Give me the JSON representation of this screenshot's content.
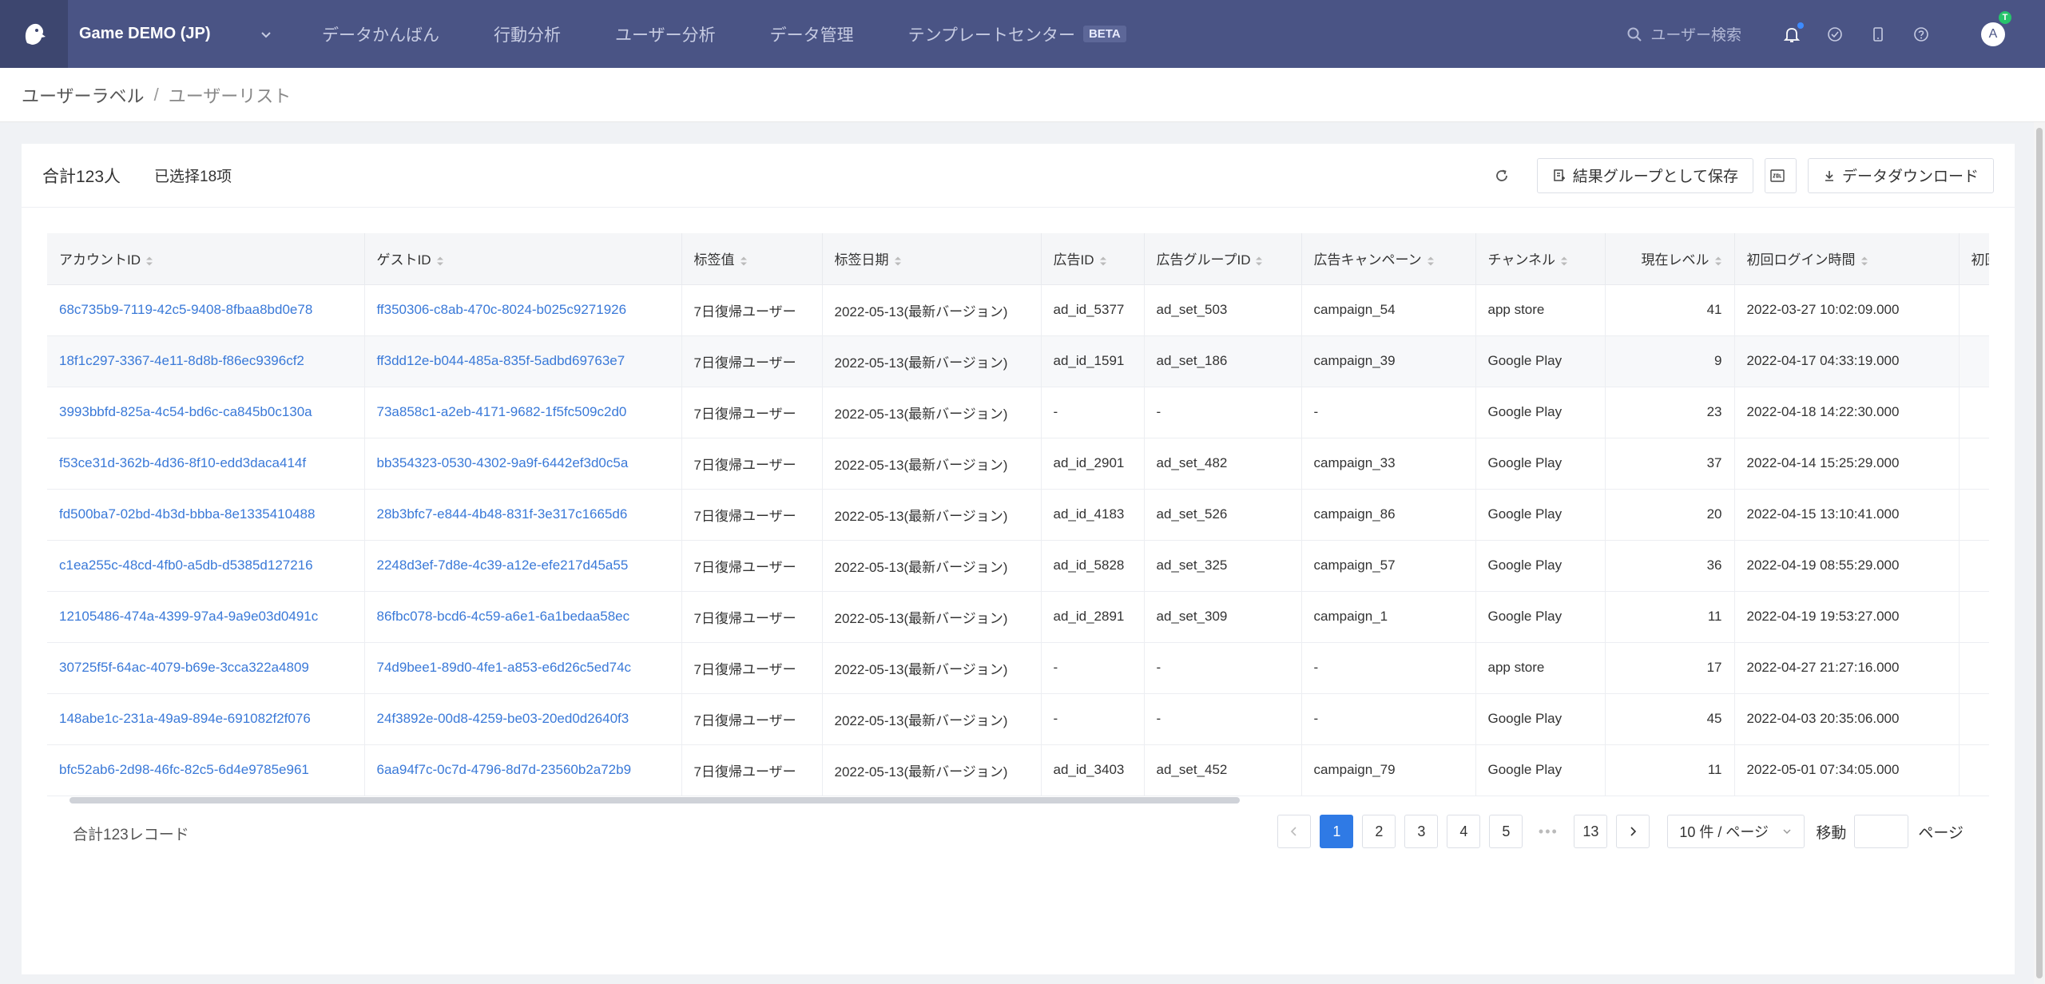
{
  "topbar": {
    "project": "Game DEMO (JP)",
    "nav": [
      {
        "label": "データかんばん"
      },
      {
        "label": "行動分析"
      },
      {
        "label": "ユーザー分析"
      },
      {
        "label": "データ管理"
      },
      {
        "label": "テンプレートセンター",
        "badge": "BETA"
      }
    ],
    "search_placeholder": "ユーザー検索",
    "avatar_initial": "A",
    "avatar_badge": "T"
  },
  "breadcrumb": {
    "parent": "ユーザーラベル",
    "separator": "/",
    "current": "ユーザーリスト"
  },
  "card": {
    "total": "合計123人",
    "selected": "已选择18项",
    "save_group_label": "結果グループとして保存",
    "download_label": "データダウンロード"
  },
  "table": {
    "columns": [
      "アカウントID",
      "ゲストID",
      "标签值",
      "标签日期",
      "広告ID",
      "広告グループID",
      "広告キャンペーン",
      "チャンネル",
      "現在レベル",
      "初回ログイン時間",
      "初回"
    ],
    "rows": [
      [
        "68c735b9-7119-42c5-9408-8fbaa8bd0e78",
        "ff350306-c8ab-470c-8024-b025c9271926",
        "7日復帰ユーザー",
        "2022-05-13(最新バージョン)",
        "ad_id_5377",
        "ad_set_503",
        "campaign_54",
        "app store",
        "41",
        "2022-03-27 10:02:09.000"
      ],
      [
        "18f1c297-3367-4e11-8d8b-f86ec9396cf2",
        "ff3dd12e-b044-485a-835f-5adbd69763e7",
        "7日復帰ユーザー",
        "2022-05-13(最新バージョン)",
        "ad_id_1591",
        "ad_set_186",
        "campaign_39",
        "Google Play",
        "9",
        "2022-04-17 04:33:19.000"
      ],
      [
        "3993bbfd-825a-4c54-bd6c-ca845b0c130a",
        "73a858c1-a2eb-4171-9682-1f5fc509c2d0",
        "7日復帰ユーザー",
        "2022-05-13(最新バージョン)",
        "-",
        "-",
        "-",
        "Google Play",
        "23",
        "2022-04-18 14:22:30.000"
      ],
      [
        "f53ce31d-362b-4d36-8f10-edd3daca414f",
        "bb354323-0530-4302-9a9f-6442ef3d0c5a",
        "7日復帰ユーザー",
        "2022-05-13(最新バージョン)",
        "ad_id_2901",
        "ad_set_482",
        "campaign_33",
        "Google Play",
        "37",
        "2022-04-14 15:25:29.000"
      ],
      [
        "fd500ba7-02bd-4b3d-bbba-8e1335410488",
        "28b3bfc7-e844-4b48-831f-3e317c1665d6",
        "7日復帰ユーザー",
        "2022-05-13(最新バージョン)",
        "ad_id_4183",
        "ad_set_526",
        "campaign_86",
        "Google Play",
        "20",
        "2022-04-15 13:10:41.000"
      ],
      [
        "c1ea255c-48cd-4fb0-a5db-d5385d127216",
        "2248d3ef-7d8e-4c39-a12e-efe217d45a55",
        "7日復帰ユーザー",
        "2022-05-13(最新バージョン)",
        "ad_id_5828",
        "ad_set_325",
        "campaign_57",
        "Google Play",
        "36",
        "2022-04-19 08:55:29.000"
      ],
      [
        "12105486-474a-4399-97a4-9a9e03d0491c",
        "86fbc078-bcd6-4c59-a6e1-6a1bedaa58ec",
        "7日復帰ユーザー",
        "2022-05-13(最新バージョン)",
        "ad_id_2891",
        "ad_set_309",
        "campaign_1",
        "Google Play",
        "11",
        "2022-04-19 19:53:27.000"
      ],
      [
        "30725f5f-64ac-4079-b69e-3cca322a4809",
        "74d9bee1-89d0-4fe1-a853-e6d26c5ed74c",
        "7日復帰ユーザー",
        "2022-05-13(最新バージョン)",
        "-",
        "-",
        "-",
        "app store",
        "17",
        "2022-04-27 21:27:16.000"
      ],
      [
        "148abe1c-231a-49a9-894e-691082f2f076",
        "24f3892e-00d8-4259-be03-20ed0d2640f3",
        "7日復帰ユーザー",
        "2022-05-13(最新バージョン)",
        "-",
        "-",
        "-",
        "Google Play",
        "45",
        "2022-04-03 20:35:06.000"
      ],
      [
        "bfc52ab6-2d98-46fc-82c5-6d4e9785e961",
        "6aa94f7c-0c7d-4796-8d7d-23560b2a72b9",
        "7日復帰ユーザー",
        "2022-05-13(最新バージョン)",
        "ad_id_3403",
        "ad_set_452",
        "campaign_79",
        "Google Play",
        "11",
        "2022-05-01 07:34:05.000"
      ]
    ]
  },
  "footer": {
    "total_records": "合計123レコード",
    "pages": [
      "1",
      "2",
      "3",
      "4",
      "5"
    ],
    "ellipsis": "•••",
    "last_page": "13",
    "current_page": "1",
    "page_size": "10 件 / ページ",
    "jump_label": "移動",
    "page_label": "ページ"
  },
  "colors": {
    "nav_bg": "#4a5485",
    "link": "#3a79d8",
    "active_page": "#2f7ae5"
  }
}
